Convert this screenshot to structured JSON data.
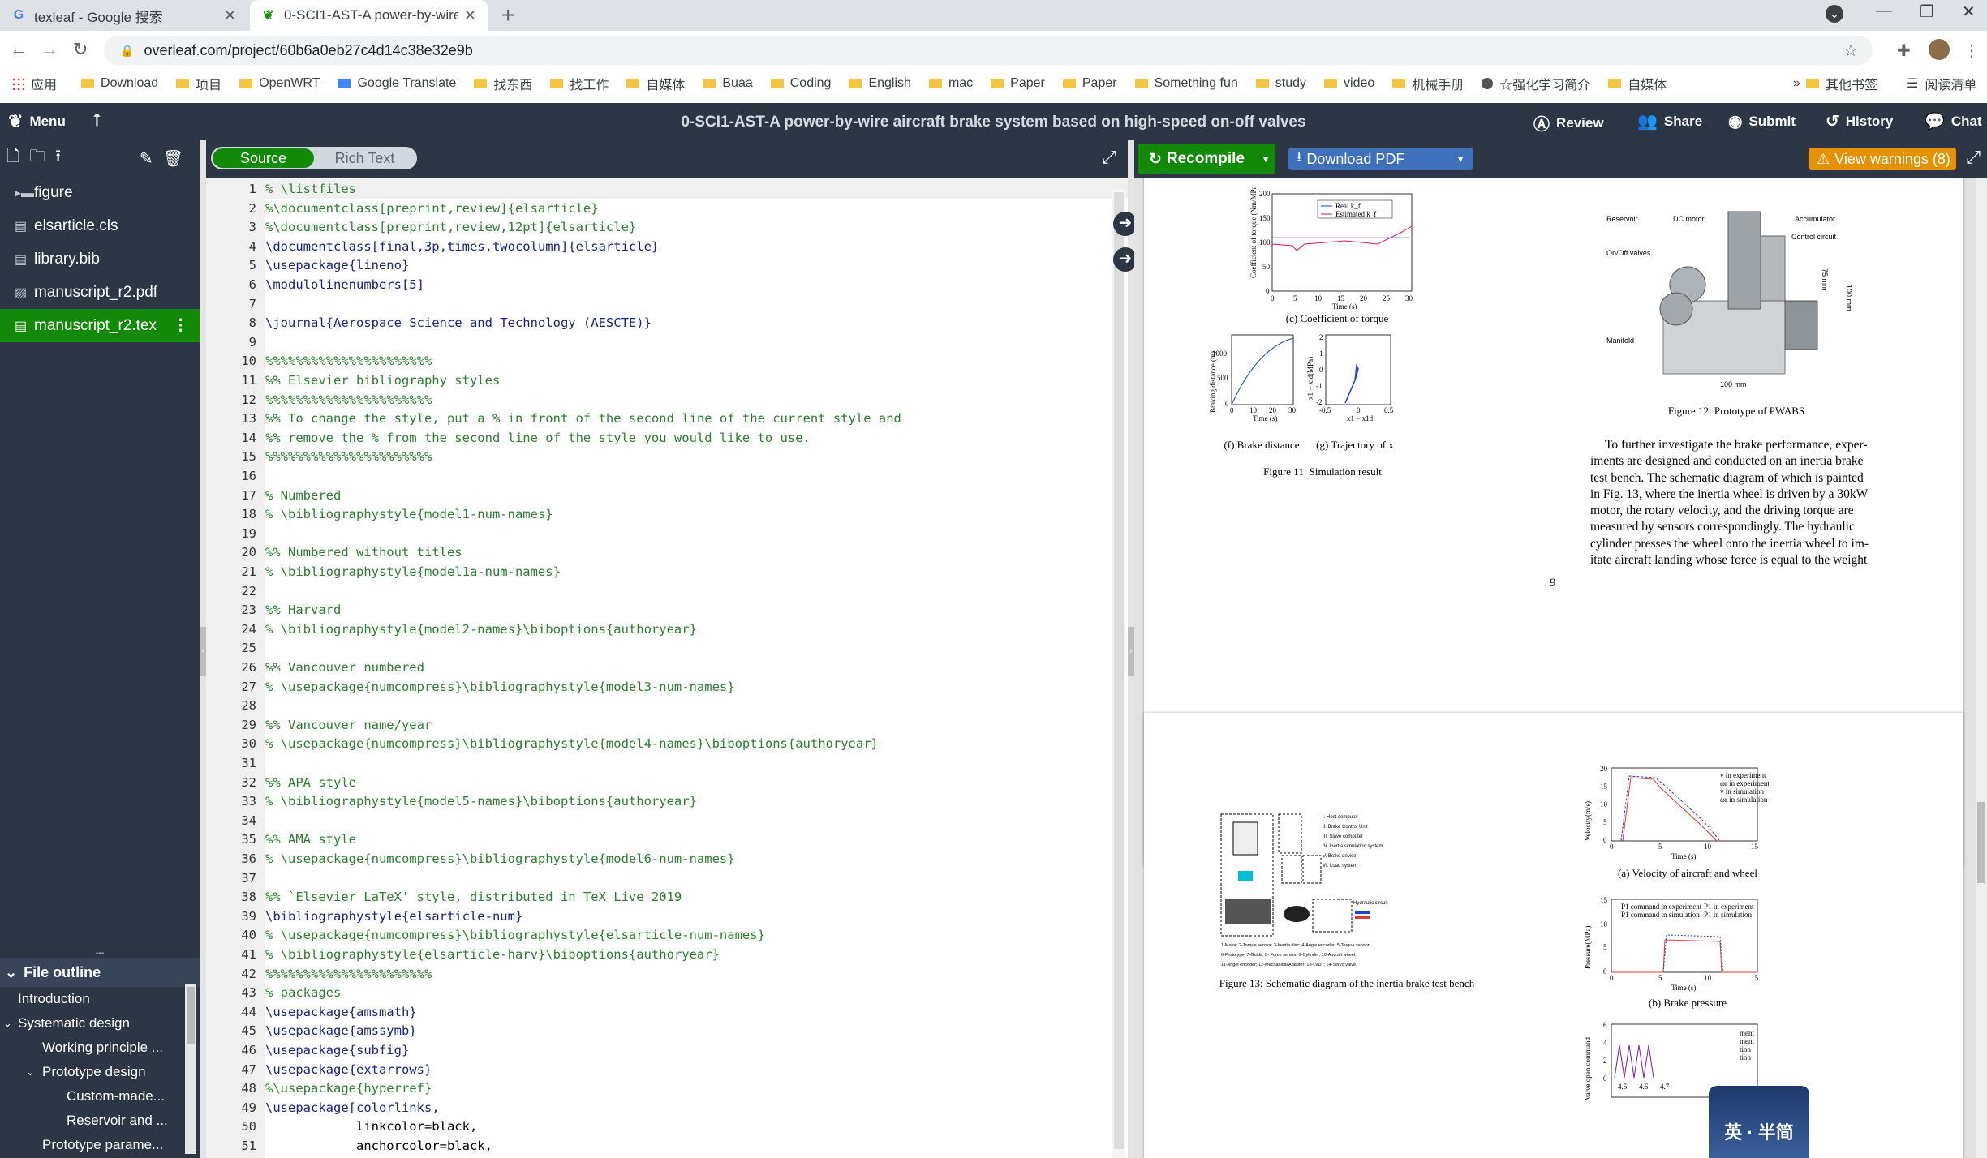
{
  "browser": {
    "tabs": [
      {
        "title": "texleaf - Google 搜索",
        "active": false,
        "favicon": "google-icon"
      },
      {
        "title": "0-SCI1-AST-A power-by-wire",
        "active": true,
        "favicon": "overleaf-icon"
      }
    ],
    "url": "overleaf.com/project/60b6a0eb27c4d14c38e32e9b",
    "bookmarks": [
      "应用",
      "Download",
      "项目",
      "OpenWRT",
      "Google Translate",
      "找东西",
      "找工作",
      "自媒体",
      "Buaa",
      "Coding",
      "English",
      "mac",
      "Paper",
      "Paper",
      "Something fun",
      "study",
      "video",
      "机械手册",
      "☆强化学习简介",
      "自媒体"
    ],
    "bookmarks_right": [
      "»",
      "其他书签",
      "阅读清单"
    ]
  },
  "toolbar": {
    "menu_label": "Menu",
    "project_title": "0-SCI1-AST-A power-by-wire aircraft brake system based on high-speed on-off valves",
    "review": "Review",
    "share": "Share",
    "submit": "Submit",
    "history": "History",
    "chat": "Chat"
  },
  "files": [
    {
      "name": "figure",
      "type": "folder"
    },
    {
      "name": "elsarticle.cls",
      "type": "file"
    },
    {
      "name": "library.bib",
      "type": "file"
    },
    {
      "name": "manuscript_r2.pdf",
      "type": "image"
    },
    {
      "name": "manuscript_r2.tex",
      "type": "file",
      "selected": true
    }
  ],
  "outline": {
    "title": "File outline",
    "items": [
      {
        "label": "Introduction",
        "level": 0
      },
      {
        "label": "Systematic design",
        "level": 0,
        "expanded": true
      },
      {
        "label": "Working principle ...",
        "level": 1
      },
      {
        "label": "Prototype design",
        "level": 1,
        "expanded": true
      },
      {
        "label": "Custom-made...",
        "level": 2
      },
      {
        "label": "Reservoir and ...",
        "level": 2
      },
      {
        "label": "Prototype parame...",
        "level": 1
      }
    ]
  },
  "editor": {
    "source_label": "Source",
    "richtext_label": "Rich Text",
    "lines": [
      {
        "n": "1",
        "text": "% \\listfiles",
        "kind": "comment"
      },
      {
        "n": "2",
        "text": "%\\documentclass[preprint,review]{elsarticle}",
        "kind": "comment"
      },
      {
        "n": "3",
        "text": "%\\documentclass[preprint,review,12pt]{elsarticle}",
        "kind": "comment"
      },
      {
        "n": "4",
        "text": "\\documentclass[final,3p,times,twocolumn]{elsarticle}",
        "kind": "cmd"
      },
      {
        "n": "5",
        "text": "\\usepackage{lineno}",
        "kind": "cmd"
      },
      {
        "n": "6",
        "text": "\\modulolinenumbers[5]",
        "kind": "cmd"
      },
      {
        "n": "7",
        "text": "",
        "kind": "text"
      },
      {
        "n": "8",
        "text": "\\journal{Aerospace Science and Technology (AESCTE)}",
        "kind": "cmd"
      },
      {
        "n": "9",
        "text": "",
        "kind": "text"
      },
      {
        "n": "10",
        "text": "%%%%%%%%%%%%%%%%%%%%%%",
        "kind": "comment"
      },
      {
        "n": "11",
        "text": "%% Elsevier bibliography styles",
        "kind": "comment"
      },
      {
        "n": "12",
        "text": "%%%%%%%%%%%%%%%%%%%%%%",
        "kind": "comment"
      },
      {
        "n": "13",
        "text": "%% To change the style, put a % in front of the second line of the current style and",
        "kind": "comment"
      },
      {
        "n": "14",
        "text": "%% remove the % from the second line of the style you would like to use.",
        "kind": "comment"
      },
      {
        "n": "15",
        "text": "%%%%%%%%%%%%%%%%%%%%%%",
        "kind": "comment"
      },
      {
        "n": "16",
        "text": "",
        "kind": "text"
      },
      {
        "n": "17",
        "text": "% Numbered",
        "kind": "comment"
      },
      {
        "n": "18",
        "text": "% \\bibliographystyle{model1-num-names}",
        "kind": "comment"
      },
      {
        "n": "19",
        "text": "",
        "kind": "text"
      },
      {
        "n": "20",
        "text": "%% Numbered without titles",
        "kind": "comment"
      },
      {
        "n": "21",
        "text": "% \\bibliographystyle{model1a-num-names}",
        "kind": "comment"
      },
      {
        "n": "22",
        "text": "",
        "kind": "text"
      },
      {
        "n": "23",
        "text": "%% Harvard",
        "kind": "comment"
      },
      {
        "n": "24",
        "text": "% \\bibliographystyle{model2-names}\\biboptions{authoryear}",
        "kind": "comment"
      },
      {
        "n": "25",
        "text": "",
        "kind": "text"
      },
      {
        "n": "26",
        "text": "%% Vancouver numbered",
        "kind": "comment"
      },
      {
        "n": "27",
        "text": "% \\usepackage{numcompress}\\bibliographystyle{model3-num-names}",
        "kind": "comment"
      },
      {
        "n": "28",
        "text": "",
        "kind": "text"
      },
      {
        "n": "29",
        "text": "%% Vancouver name/year",
        "kind": "comment"
      },
      {
        "n": "30",
        "text": "% \\usepackage{numcompress}\\bibliographystyle{model4-names}\\biboptions{authoryear}",
        "kind": "comment"
      },
      {
        "n": "31",
        "text": "",
        "kind": "text"
      },
      {
        "n": "32",
        "text": "%% APA style",
        "kind": "comment"
      },
      {
        "n": "33",
        "text": "% \\bibliographystyle{model5-names}\\biboptions{authoryear}",
        "kind": "comment"
      },
      {
        "n": "34",
        "text": "",
        "kind": "text"
      },
      {
        "n": "35",
        "text": "%% AMA style",
        "kind": "comment"
      },
      {
        "n": "36",
        "text": "% \\usepackage{numcompress}\\bibliographystyle{model6-num-names}",
        "kind": "comment"
      },
      {
        "n": "37",
        "text": "",
        "kind": "text"
      },
      {
        "n": "38",
        "text": "%% `Elsevier LaTeX' style, distributed in TeX Live 2019",
        "kind": "comment"
      },
      {
        "n": "39",
        "text": "\\bibliographystyle{elsarticle-num}",
        "kind": "cmd"
      },
      {
        "n": "40",
        "text": "% \\usepackage{numcompress}\\bibliographystyle{elsarticle-num-names}",
        "kind": "comment"
      },
      {
        "n": "41",
        "text": "% \\bibliographystyle{elsarticle-harv}\\biboptions{authoryear}",
        "kind": "comment"
      },
      {
        "n": "42",
        "text": "%%%%%%%%%%%%%%%%%%%%%%",
        "kind": "comment"
      },
      {
        "n": "43",
        "text": "% packages",
        "kind": "comment"
      },
      {
        "n": "44",
        "text": "\\usepackage{amsmath}",
        "kind": "cmd"
      },
      {
        "n": "45",
        "text": "\\usepackage{amssymb}",
        "kind": "cmd"
      },
      {
        "n": "46",
        "text": "\\usepackage{subfig}",
        "kind": "cmd"
      },
      {
        "n": "47",
        "text": "\\usepackage{extarrows}",
        "kind": "cmd"
      },
      {
        "n": "48",
        "text": "%\\usepackage{hyperref}",
        "kind": "comment"
      },
      {
        "n": "49",
        "text": "\\usepackage[colorlinks,",
        "kind": "cmd"
      },
      {
        "n": "50",
        "text": "            linkcolor=black,",
        "kind": "text"
      },
      {
        "n": "51",
        "text": "            anchorcolor=black,",
        "kind": "text"
      }
    ]
  },
  "pdf": {
    "recompile": "Recompile",
    "download": "Download PDF",
    "warnings": "View warnings (8)",
    "page9": {
      "fig11": {
        "sub_c": "(c) Coefficient of torque",
        "sub_f": "(f) Brake distance",
        "sub_g": "(g) Trajectory of x",
        "caption": "Figure 11: Simulation result",
        "c_ylabel": "Coefficient of torque (Nm/MPa)",
        "c_xlabel": "Time (s)",
        "c_legend": [
          "Real k_f",
          "Estimated k_f"
        ],
        "c_yticks": [
          "200",
          "150",
          "100",
          "50",
          "0"
        ],
        "c_xticks": [
          "0",
          "5",
          "10",
          "15",
          "20",
          "25",
          "30"
        ],
        "f_ylabel": "Braking distance (m)",
        "f_xlabel": "Time (s)",
        "f_yticks": [
          "1000",
          "500",
          "0"
        ],
        "f_xticks": [
          "0",
          "10",
          "20",
          "30"
        ],
        "g_ylabel": "x1 − xid(MPa)",
        "g_xlabel": "x1 − x1d",
        "g_yticks": [
          "2",
          "1",
          "0",
          "-1",
          "-2"
        ],
        "g_xticks": [
          "-0.5",
          "0",
          "0.5"
        ]
      },
      "fig12": {
        "caption": "Figure 12: Prototype of PWABS",
        "labels": [
          "Reservoir",
          "DC motor",
          "Accumulator",
          "Control circuit",
          "On/Off valves",
          "Manifold",
          "75 mm",
          "100 mm",
          "100 mm"
        ]
      },
      "paragraph": [
        "To further investigate the brake performance, exper-",
        "iments are designed and conducted on an inertia brake",
        "test bench. The schematic diagram of which is painted",
        "in Fig. 13, where the inertia wheel is driven by a 30kW",
        "motor, the rotary velocity, and the driving torque are",
        "measured by sensors correspondingly. The hydraulic",
        "cylinder presses the wheel onto the inertia wheel to im-",
        "itate aircraft landing whose force is equal to the weight"
      ],
      "fig_ref": "13",
      "page_number": "9"
    },
    "page10": {
      "fig13": {
        "caption": "Figure 13: Schematic diagram of the inertia brake test bench",
        "legend": [
          "I. Host computer",
          "II. Brake Control Unit",
          "III. Slave computer",
          "IV. Inertia simulation system",
          "V. Brake device",
          "VI. Load system"
        ],
        "hydraulic": "Hydraulic circuit",
        "notes": [
          "1-Motor; 2-Torque sensor; 3-Inertia disc; 4-Angle encoder; 5-Torque sensor;",
          "6-Prototype; 7-Guide; 8- Force sensor; 9-Cylinder; 10-Aircraft wheel;",
          "11-Angel encoder; 12-Mechanical Adapter; 13-LVDT; 14-Servo valve"
        ]
      },
      "fig14a": {
        "caption": "(a) Velocity of aircraft and wheel",
        "ylabel": "Velocity(m/s)",
        "xlabel": "Time (s)",
        "legend": [
          "v in experiment",
          "ωr in experiment",
          "v in simulation",
          "ωr in simulation"
        ],
        "yticks": [
          "20",
          "15",
          "10",
          "5",
          "0"
        ],
        "xticks": [
          "0",
          "5",
          "10",
          "15"
        ]
      },
      "fig14b": {
        "caption": "(b) Brake pressure",
        "ylabel": "Pressure(MPa)",
        "xlabel": "Time (s)",
        "legend": [
          "P1 command in experiment",
          "P1 in experiment",
          "P1 command in simulation",
          "P1 in simulation"
        ],
        "yticks": [
          "15",
          "10",
          "5",
          "0"
        ],
        "xticks": [
          "0",
          "5",
          "10",
          "15"
        ]
      },
      "fig14c": {
        "ylabel": "Valve open command",
        "xticks": [
          "4.5",
          "4.6",
          "4.7"
        ],
        "yticks": [
          "6",
          "4",
          "2",
          "0"
        ],
        "legend": [
          "ment",
          "ment",
          "tion",
          "tion"
        ]
      }
    }
  },
  "overlay_badge": "英 · 半简",
  "colors": {
    "overleaf_dark": "#2c3645",
    "overleaf_green": "#138a07",
    "download_blue": "#3e70bb",
    "warning_orange": "#e59100",
    "comment_green": "#2e7d32"
  }
}
